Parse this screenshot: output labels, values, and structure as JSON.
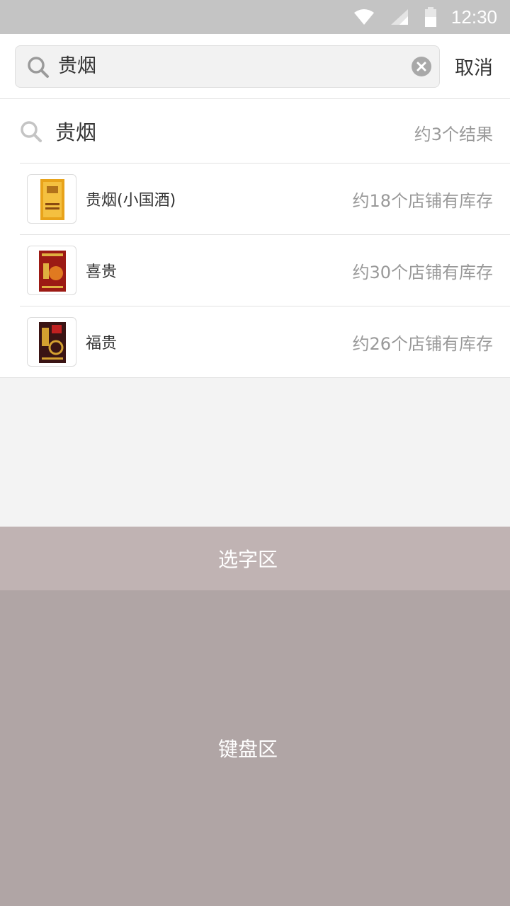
{
  "status_bar": {
    "time": "12:30",
    "icons": [
      "wifi-icon",
      "cell-signal-icon",
      "battery-icon"
    ]
  },
  "search": {
    "query": "贵烟",
    "cancel_label": "取消",
    "icons": [
      "search-icon",
      "clear-icon"
    ]
  },
  "results": {
    "summary_query": "贵烟",
    "summary_count": "约3个结果",
    "items": [
      {
        "name": "贵烟(小国酒)",
        "stock": "约18个店铺有库存",
        "thumb_color": "#e8a31a"
      },
      {
        "name": "喜贵",
        "stock": "约30个店铺有库存",
        "thumb_color": "#9c1a14"
      },
      {
        "name": "福贵",
        "stock": "约26个店铺有库存",
        "thumb_color": "#3a1414"
      }
    ]
  },
  "ime": {
    "candidate_label": "选字区",
    "keyboard_label": "键盘区"
  },
  "colors": {
    "status_bar": "#c4c4c4",
    "candidate_area": "#c0b3b3",
    "keyboard_area": "#b0a5a5",
    "secondary_text": "#999999"
  }
}
